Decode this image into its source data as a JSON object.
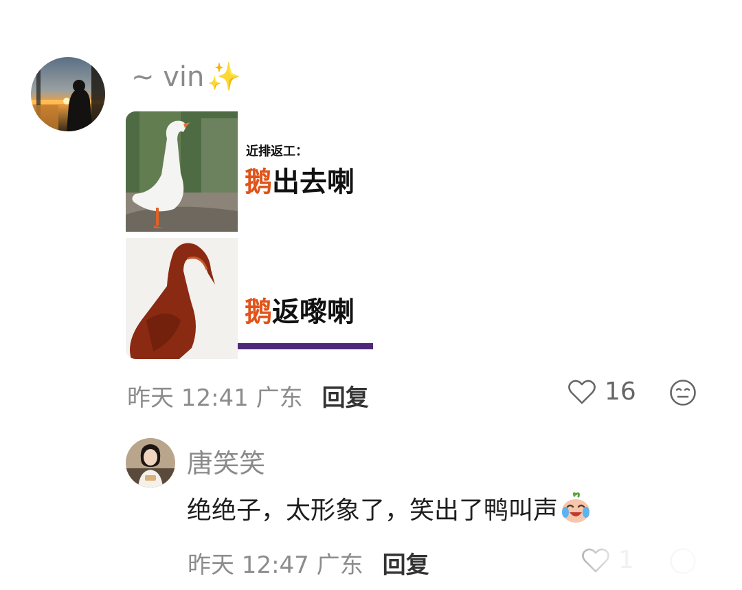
{
  "comment": {
    "user": {
      "name": "~ vin",
      "badge_emoji": "✨"
    },
    "sticker": {
      "top_caption": "近排返工：",
      "top_highlight": "鹅",
      "top_rest": "出去喇",
      "bottom_highlight": "鹅",
      "bottom_rest": "返嚟喇",
      "colors": {
        "highlight": "#e0531a",
        "divider": "#4d2a79"
      }
    },
    "meta": {
      "time": "昨天 12:41 广东",
      "reply_label": "回复"
    },
    "likes": {
      "count": "16",
      "icon": "heart-outline-icon"
    },
    "reaction_icon": "face-emoji-icon"
  },
  "reply": {
    "user": {
      "name": "唐笑笑"
    },
    "text": "绝绝子，太形象了，笑出了鸭叫声",
    "text_emoji": "laughing-tears-face-icon",
    "meta": {
      "time": "昨天 12:47 广东",
      "reply_label": "回复"
    },
    "likes": {
      "count": "1",
      "icon": "heart-outline-icon"
    }
  }
}
